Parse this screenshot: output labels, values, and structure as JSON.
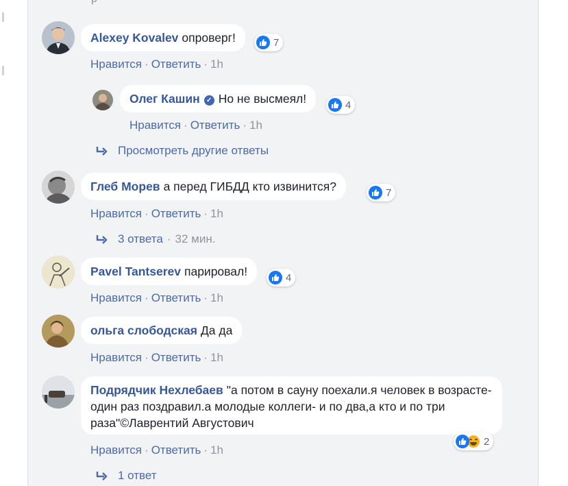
{
  "top_remnant": "р",
  "comments": [
    {
      "author": "Alexey Kovalev",
      "text": "опроверг!",
      "reactions": "7",
      "actions": {
        "like": "Нравится",
        "reply": "Ответить",
        "time": "1h"
      }
    },
    {
      "author": "Олег Кашин",
      "verified": true,
      "text": "Но не высмеял!",
      "reactions": "4",
      "actions": {
        "like": "Нравится",
        "reply": "Ответить",
        "time": "1h"
      }
    },
    {
      "author": "Глеб Морев",
      "text": "а перед ГИБДД кто извинится?",
      "reactions": "7",
      "actions": {
        "like": "Нравится",
        "reply": "Ответить",
        "time": "1h"
      }
    },
    {
      "author": "Pavel Tantserev",
      "text": "парировал!",
      "reactions": "4",
      "actions": {
        "like": "Нравится",
        "reply": "Ответить",
        "time": "1h"
      }
    },
    {
      "author": "ольга слободская",
      "text": "Да да",
      "actions": {
        "like": "Нравится",
        "reply": "Ответить",
        "time": "1h"
      }
    },
    {
      "author": "Подрядчик Нехлебаев",
      "text": "\"а потом в сауну поехали.я человек в возрасте-один раз поздравил.а молодые коллеги- и по два,а кто и по три раза\"©Лаврентий Августович",
      "reactions": "2",
      "actions": {
        "like": "Нравится",
        "reply": "Ответить",
        "time": "1h"
      }
    }
  ],
  "view_more_replies": "Просмотреть другие ответы",
  "gleb_replies": {
    "label": "3 ответа",
    "time": "32 мин."
  },
  "podryadchik_replies": {
    "label": "1 ответ"
  },
  "colors": {
    "panel_bg": "#f2f3f5",
    "author": "#365899",
    "link": "#4b6aa8",
    "like_blue": "#1877f2",
    "haha_yellow": "#f7b125"
  },
  "icons": [
    "like-icon",
    "haha-icon",
    "verified-icon",
    "reply-arrow-icon"
  ]
}
